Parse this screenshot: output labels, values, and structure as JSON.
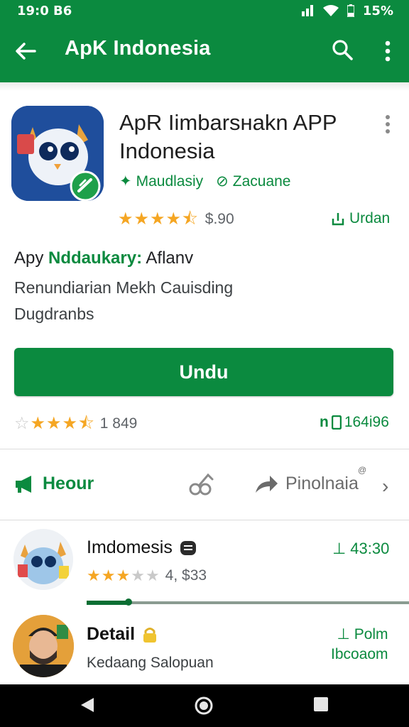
{
  "status_bar": {
    "time": "19:0 B6",
    "battery": "15%"
  },
  "app_bar": {
    "title": "ApK Indonesia"
  },
  "app": {
    "title": "ApR Iimbarsнakn APP Indonesia",
    "developer": "Maudlasiy",
    "badge": "Zacuane",
    "rating_value": "$.90",
    "rating_stars": 4.5,
    "action_link": "Urdan"
  },
  "description": {
    "prefix": "Apy ",
    "accent": "Nddaukary:",
    "suffix": " Aflanv",
    "line2": "Renundiarian Mekh Cauisding",
    "line3": "Dugdranbs"
  },
  "install_button": {
    "label": "Undu"
  },
  "rating_summary": {
    "value": "1 849",
    "stars": 3.5
  },
  "downloads": {
    "prefix": "n",
    "value": "164i96"
  },
  "actions": {
    "heur_label": "Heour",
    "pin_label": "Pinolnaia",
    "pin_badge": "@"
  },
  "list": [
    {
      "title": "Imdomesis",
      "rating_value": "4, $33",
      "stars": 3.5,
      "right_value": "43:30",
      "progress": 0.13
    },
    {
      "title": "Detail",
      "subtitle": "Kedaang Salopuan",
      "right_line1": "Polm",
      "right_line2": "Ibcoaom"
    }
  ],
  "colors": {
    "primary": "#0b8a3f",
    "star": "#f5a623",
    "icon_bg": "#1f4e9c"
  },
  "icons": [
    "back-arrow-icon",
    "search-icon",
    "more-vert-icon",
    "share-icon",
    "forward-icon",
    "chevron-right-icon",
    "download-icon"
  ]
}
